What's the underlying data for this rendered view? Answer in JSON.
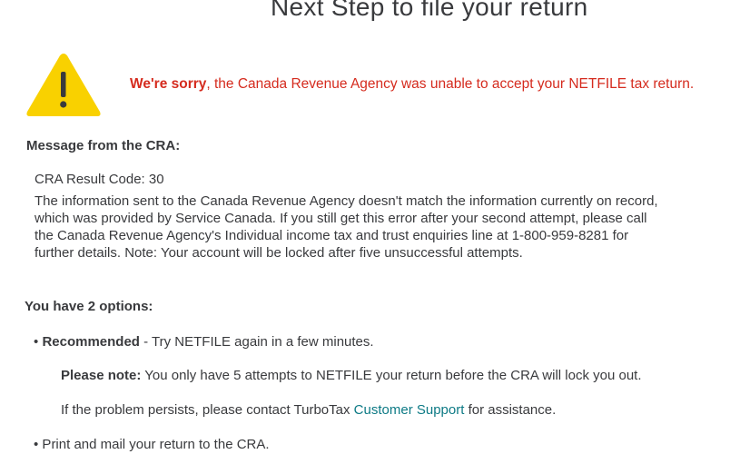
{
  "page": {
    "title": "Next Step to file your return"
  },
  "alert": {
    "icon": "warning-icon",
    "icon_color": "#f9d100",
    "emphasis": "We're sorry",
    "text": ", the Canada Revenue Agency was unable to accept your NETFILE tax return.",
    "color": "#d52b1e"
  },
  "cra": {
    "heading": "Message from the CRA:",
    "result_code": "CRA Result Code: 30",
    "message": "The information sent to the Canada Revenue Agency doesn't match the information currently on record, which was provided by Service Canada. If you still get this error after your second attempt, please call the Canada Revenue Agency's Individual income tax and trust enquiries line at 1-800-959-8281 for further details. Note: Your account will be locked after five unsuccessful attempts."
  },
  "options": {
    "heading": "You have 2 options:",
    "option1": {
      "bullet": "•",
      "label": "Recommended",
      "text": " - Try NETFILE again in a few minutes."
    },
    "note": {
      "label": "Please note:",
      "text": " You only have 5 attempts to NETFILE your return before the CRA will lock you out."
    },
    "persists": {
      "before": "If the problem persists, please contact TurboTax ",
      "link": "Customer Support",
      "after": " for assistance.",
      "link_color": "#0d7a85"
    },
    "option2": {
      "bullet": "•",
      "text": " Print and mail your return to the CRA."
    }
  }
}
